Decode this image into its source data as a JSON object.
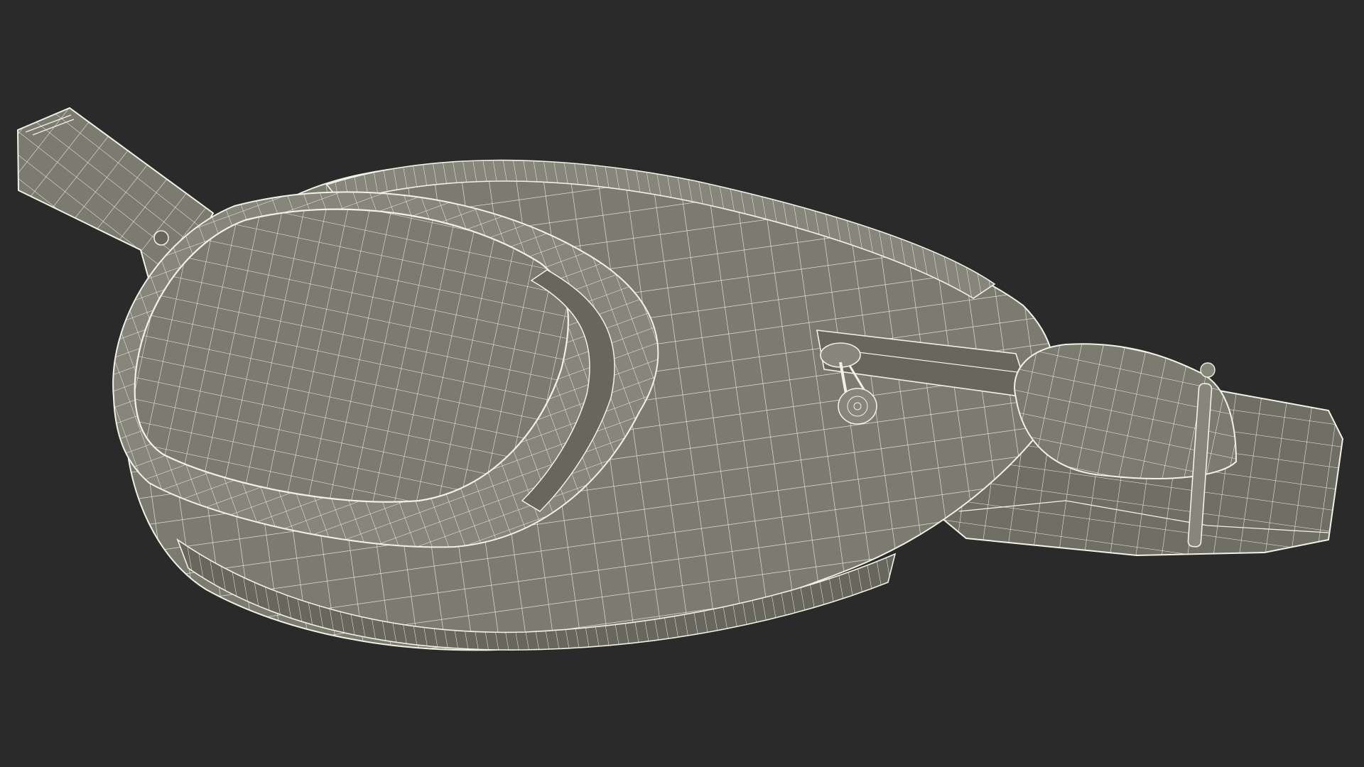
{
  "scene": {
    "background_color": "#2a2a2a",
    "mesh_fill": "#7b7b70",
    "mesh_fill_shadow": "#67675e",
    "mesh_fill_light": "#86867a",
    "wire_color": "#f1f1e6",
    "subject": "waist-bag-wireframe"
  }
}
